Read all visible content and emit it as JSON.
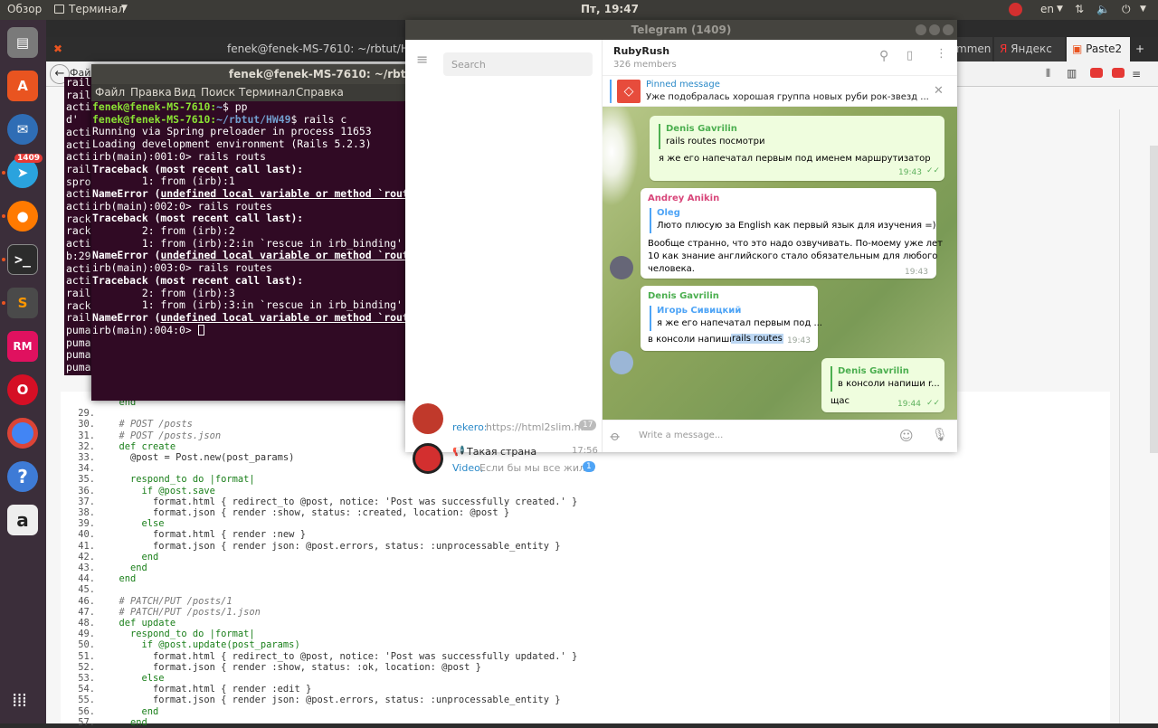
{
  "topbar": {
    "activities": "Обзор",
    "app_menu": "Терминал",
    "clock": "Пт, 19:47",
    "lang": "en"
  },
  "dock": {
    "telegram_badge": "1409",
    "rm_label": "RM",
    "sublime_label": "S"
  },
  "browser": {
    "window_title": "fenek@fenek-MS-7610: ~/rbtut/HW49",
    "tabs": [
      "mmen",
      "Яндекс",
      "Paste2"
    ],
    "menu_partial": "Фай"
  },
  "terminal": {
    "title": "fenek@fenek-MS-7610: ~/rbtut/HW49",
    "menu": [
      "Файл",
      "Правка",
      "Вид",
      "Поиск",
      "Терминал",
      "Справка"
    ],
    "left_fragments": [
      "rail",
      "rail",
      "acti",
      "d'",
      "acti",
      "acti",
      "acti",
      "rail",
      "spro",
      "acti",
      "acti",
      "rack",
      "rack",
      "acti",
      "b:29",
      "acti",
      "acti",
      "rail",
      "rack",
      "rail",
      "puma",
      "puma",
      "puma",
      "puma"
    ],
    "lines": [
      {
        "prompt": "fenek@fenek-MS-7610",
        "path": "~",
        "cmd": "$ pp"
      },
      {
        "prompt": "fenek@fenek-MS-7610",
        "path": "~/rbtut/HW49",
        "cmd": "$ rails c"
      },
      {
        "text": "Running via Spring preloader in process 11653"
      },
      {
        "text": "Loading development environment (Rails 5.2.3)"
      },
      {
        "text": "irb(main):001:0> rails routs"
      },
      {
        "text": "Traceback (most recent call last):",
        "bold": true
      },
      {
        "text": "        1: from (irb):1"
      },
      {
        "err": "NameError",
        "msg": "undefined local variable or method `routs' for main:Object"
      },
      {
        "text": "irb(main):002:0> rails routes"
      },
      {
        "text": "Traceback (most recent call last):",
        "bold": true
      },
      {
        "text": "        2: from (irb):2"
      },
      {
        "text": "        1: from (irb):2:in `rescue in irb_binding'"
      },
      {
        "err": "NameError",
        "msg": "undefined local variable or method `routes' for main:Object"
      },
      {
        "text": "irb(main):003:0> rails routes"
      },
      {
        "text": "Traceback (most recent call last):",
        "bold": true
      },
      {
        "text": "        2: from (irb):3"
      },
      {
        "text": "        1: from (irb):3:in `rescue in irb_binding'"
      },
      {
        "err": "NameError",
        "msg": "undefined local variable or method `routes' for main:Object"
      },
      {
        "text": "irb(main):004:0> "
      }
    ]
  },
  "code": [
    {
      "n": "",
      "t": "  end"
    },
    {
      "n": "29.",
      "t": ""
    },
    {
      "n": "30.",
      "t": "  # POST /posts"
    },
    {
      "n": "31.",
      "t": "  # POST /posts.json"
    },
    {
      "n": "32.",
      "t": "  def create"
    },
    {
      "n": "33.",
      "t": "    @post = Post.new(post_params)"
    },
    {
      "n": "34.",
      "t": ""
    },
    {
      "n": "35.",
      "t": "    respond_to do |format|"
    },
    {
      "n": "36.",
      "t": "      if @post.save"
    },
    {
      "n": "37.",
      "t": "        format.html { redirect_to @post, notice: 'Post was successfully created.' }"
    },
    {
      "n": "38.",
      "t": "        format.json { render :show, status: :created, location: @post }"
    },
    {
      "n": "39.",
      "t": "      else"
    },
    {
      "n": "40.",
      "t": "        format.html { render :new }"
    },
    {
      "n": "41.",
      "t": "        format.json { render json: @post.errors, status: :unprocessable_entity }"
    },
    {
      "n": "42.",
      "t": "      end"
    },
    {
      "n": "43.",
      "t": "    end"
    },
    {
      "n": "44.",
      "t": "  end"
    },
    {
      "n": "45.",
      "t": ""
    },
    {
      "n": "46.",
      "t": "  # PATCH/PUT /posts/1"
    },
    {
      "n": "47.",
      "t": "  # PATCH/PUT /posts/1.json"
    },
    {
      "n": "48.",
      "t": "  def update"
    },
    {
      "n": "49.",
      "t": "    respond_to do |format|"
    },
    {
      "n": "50.",
      "t": "      if @post.update(post_params)"
    },
    {
      "n": "51.",
      "t": "        format.html { redirect_to @post, notice: 'Post was successfully updated.' }"
    },
    {
      "n": "52.",
      "t": "        format.json { render :show, status: :ok, location: @post }"
    },
    {
      "n": "53.",
      "t": "      else"
    },
    {
      "n": "54.",
      "t": "        format.html { render :edit }"
    },
    {
      "n": "55.",
      "t": "        format.json { render json: @post.errors, status: :unprocessable_entity }"
    },
    {
      "n": "56.",
      "t": "      end"
    },
    {
      "n": "57.",
      "t": "    end"
    }
  ],
  "telegram": {
    "title": "Telegram (1409)",
    "search_placeholder": "Search",
    "chat_name": "RubyRush",
    "members": "326 members",
    "pinned_label": "Pinned message",
    "pinned_text": "Уже подобралась хорошая группа новых руби рок-звезд ...",
    "message_placeholder": "Write a message...",
    "chats": [
      {
        "name": "",
        "preview_sender": "rekero:",
        "preview": "https://html2slim.h...",
        "badge": "17"
      },
      {
        "name": "Такая страна",
        "time": "17:56",
        "preview_sender": "Video,",
        "preview": "Если бы мы все жил...",
        "badge": "1"
      }
    ],
    "messages": [
      {
        "reply_author": "Denis Gavrilin",
        "reply_text": "rails routes посмотри",
        "text": "я же его напечатал первым под именем маршрутизатор",
        "time": "19:43"
      },
      {
        "author": "Andrey Anikin",
        "reply_author": "Oleg",
        "reply_text": "Лютo плюсую за English как первый язык для изучения =)",
        "text_lines": [
          "Вообще странно, что это надо озвучивать. По-моему уже лет",
          "10 как знание английского стало обязательным для любого",
          "человека."
        ],
        "time": "19:43"
      },
      {
        "author": "Denis Gavrilin",
        "reply_author": "Игорь Сивицкий",
        "reply_text": "я же его напечатал первым под ...",
        "text": "в консоли напиши",
        "highlight": "rails routes",
        "time": "19:43"
      },
      {
        "reply_author": "Denis Gavrilin",
        "reply_text": "в консоли напиши r...",
        "text": "щас",
        "time": "19:44"
      }
    ]
  }
}
